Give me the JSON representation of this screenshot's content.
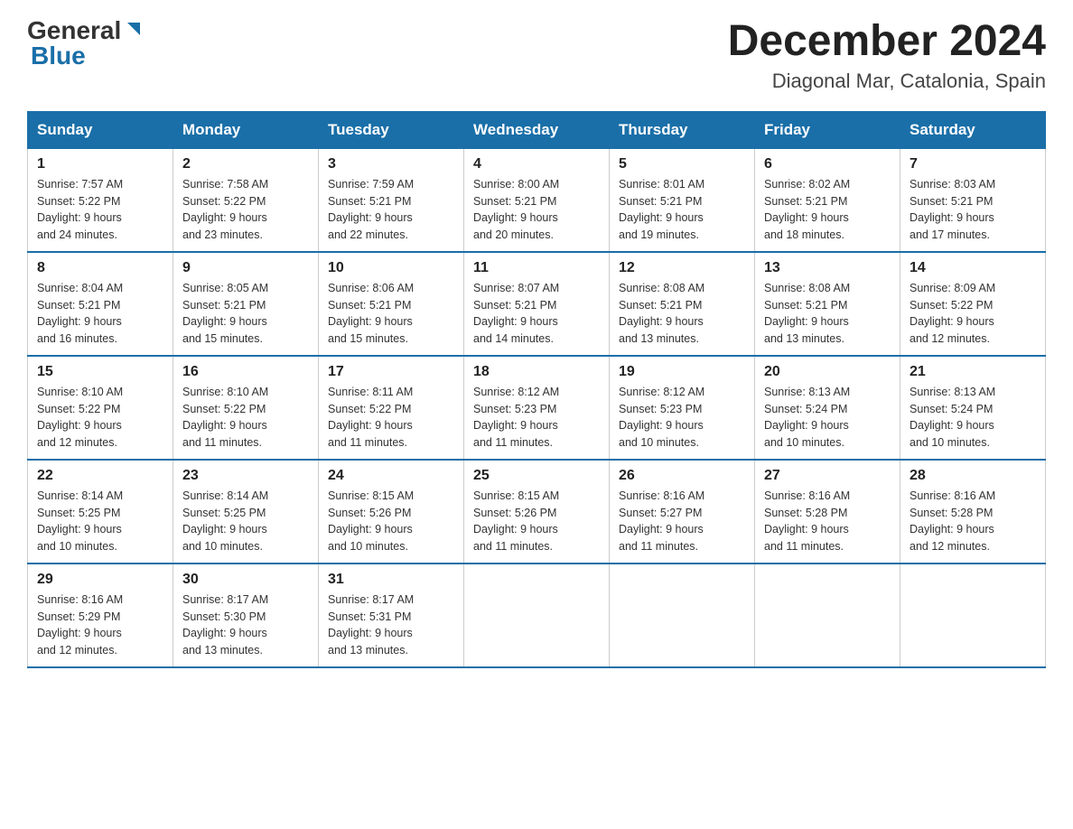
{
  "header": {
    "logo_general": "General",
    "logo_blue": "Blue",
    "month_year": "December 2024",
    "location": "Diagonal Mar, Catalonia, Spain"
  },
  "days_of_week": [
    "Sunday",
    "Monday",
    "Tuesday",
    "Wednesday",
    "Thursday",
    "Friday",
    "Saturday"
  ],
  "weeks": [
    [
      {
        "day": "1",
        "sunrise": "7:57 AM",
        "sunset": "5:22 PM",
        "daylight": "9 hours and 24 minutes."
      },
      {
        "day": "2",
        "sunrise": "7:58 AM",
        "sunset": "5:22 PM",
        "daylight": "9 hours and 23 minutes."
      },
      {
        "day": "3",
        "sunrise": "7:59 AM",
        "sunset": "5:21 PM",
        "daylight": "9 hours and 22 minutes."
      },
      {
        "day": "4",
        "sunrise": "8:00 AM",
        "sunset": "5:21 PM",
        "daylight": "9 hours and 20 minutes."
      },
      {
        "day": "5",
        "sunrise": "8:01 AM",
        "sunset": "5:21 PM",
        "daylight": "9 hours and 19 minutes."
      },
      {
        "day": "6",
        "sunrise": "8:02 AM",
        "sunset": "5:21 PM",
        "daylight": "9 hours and 18 minutes."
      },
      {
        "day": "7",
        "sunrise": "8:03 AM",
        "sunset": "5:21 PM",
        "daylight": "9 hours and 17 minutes."
      }
    ],
    [
      {
        "day": "8",
        "sunrise": "8:04 AM",
        "sunset": "5:21 PM",
        "daylight": "9 hours and 16 minutes."
      },
      {
        "day": "9",
        "sunrise": "8:05 AM",
        "sunset": "5:21 PM",
        "daylight": "9 hours and 15 minutes."
      },
      {
        "day": "10",
        "sunrise": "8:06 AM",
        "sunset": "5:21 PM",
        "daylight": "9 hours and 15 minutes."
      },
      {
        "day": "11",
        "sunrise": "8:07 AM",
        "sunset": "5:21 PM",
        "daylight": "9 hours and 14 minutes."
      },
      {
        "day": "12",
        "sunrise": "8:08 AM",
        "sunset": "5:21 PM",
        "daylight": "9 hours and 13 minutes."
      },
      {
        "day": "13",
        "sunrise": "8:08 AM",
        "sunset": "5:21 PM",
        "daylight": "9 hours and 13 minutes."
      },
      {
        "day": "14",
        "sunrise": "8:09 AM",
        "sunset": "5:22 PM",
        "daylight": "9 hours and 12 minutes."
      }
    ],
    [
      {
        "day": "15",
        "sunrise": "8:10 AM",
        "sunset": "5:22 PM",
        "daylight": "9 hours and 12 minutes."
      },
      {
        "day": "16",
        "sunrise": "8:10 AM",
        "sunset": "5:22 PM",
        "daylight": "9 hours and 11 minutes."
      },
      {
        "day": "17",
        "sunrise": "8:11 AM",
        "sunset": "5:22 PM",
        "daylight": "9 hours and 11 minutes."
      },
      {
        "day": "18",
        "sunrise": "8:12 AM",
        "sunset": "5:23 PM",
        "daylight": "9 hours and 11 minutes."
      },
      {
        "day": "19",
        "sunrise": "8:12 AM",
        "sunset": "5:23 PM",
        "daylight": "9 hours and 10 minutes."
      },
      {
        "day": "20",
        "sunrise": "8:13 AM",
        "sunset": "5:24 PM",
        "daylight": "9 hours and 10 minutes."
      },
      {
        "day": "21",
        "sunrise": "8:13 AM",
        "sunset": "5:24 PM",
        "daylight": "9 hours and 10 minutes."
      }
    ],
    [
      {
        "day": "22",
        "sunrise": "8:14 AM",
        "sunset": "5:25 PM",
        "daylight": "9 hours and 10 minutes."
      },
      {
        "day": "23",
        "sunrise": "8:14 AM",
        "sunset": "5:25 PM",
        "daylight": "9 hours and 10 minutes."
      },
      {
        "day": "24",
        "sunrise": "8:15 AM",
        "sunset": "5:26 PM",
        "daylight": "9 hours and 10 minutes."
      },
      {
        "day": "25",
        "sunrise": "8:15 AM",
        "sunset": "5:26 PM",
        "daylight": "9 hours and 11 minutes."
      },
      {
        "day": "26",
        "sunrise": "8:16 AM",
        "sunset": "5:27 PM",
        "daylight": "9 hours and 11 minutes."
      },
      {
        "day": "27",
        "sunrise": "8:16 AM",
        "sunset": "5:28 PM",
        "daylight": "9 hours and 11 minutes."
      },
      {
        "day": "28",
        "sunrise": "8:16 AM",
        "sunset": "5:28 PM",
        "daylight": "9 hours and 12 minutes."
      }
    ],
    [
      {
        "day": "29",
        "sunrise": "8:16 AM",
        "sunset": "5:29 PM",
        "daylight": "9 hours and 12 minutes."
      },
      {
        "day": "30",
        "sunrise": "8:17 AM",
        "sunset": "5:30 PM",
        "daylight": "9 hours and 13 minutes."
      },
      {
        "day": "31",
        "sunrise": "8:17 AM",
        "sunset": "5:31 PM",
        "daylight": "9 hours and 13 minutes."
      },
      null,
      null,
      null,
      null
    ]
  ],
  "labels": {
    "sunrise": "Sunrise:",
    "sunset": "Sunset:",
    "daylight": "Daylight:"
  }
}
